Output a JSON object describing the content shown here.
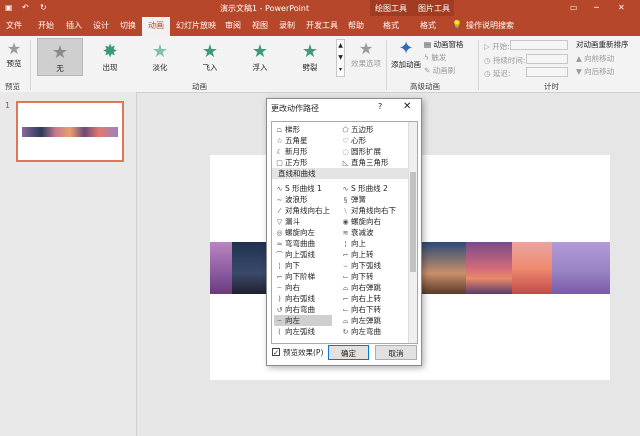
{
  "title_bar": {
    "autosave_icons": "undo-redo",
    "doc_title": "演示文稿1 - PowerPoint",
    "context_tool_drawing": "绘图工具",
    "context_tool_picture": "图片工具"
  },
  "tabs": [
    {
      "label": "文件"
    },
    {
      "label": "开始"
    },
    {
      "label": "插入"
    },
    {
      "label": "设计"
    },
    {
      "label": "切换"
    },
    {
      "label": "动画",
      "active": true
    },
    {
      "label": "幻灯片放映"
    },
    {
      "label": "审阅"
    },
    {
      "label": "视图"
    },
    {
      "label": "录制"
    },
    {
      "label": "开发工具"
    },
    {
      "label": "帮助"
    },
    {
      "label": "格式"
    },
    {
      "label": "格式"
    }
  ],
  "tell_me": "操作说明搜索",
  "ribbon": {
    "preview": {
      "label": "预览",
      "group": "预览"
    },
    "animations": [
      {
        "label": "无",
        "selected": true,
        "color": "#8a8a8a"
      },
      {
        "label": "出现",
        "color": "#3c9a7a"
      },
      {
        "label": "淡化",
        "color": "#3c9a7a"
      },
      {
        "label": "飞入",
        "color": "#3c9a7a"
      },
      {
        "label": "浮入",
        "color": "#3c9a7a"
      },
      {
        "label": "劈裂",
        "color": "#3c9a7a"
      }
    ],
    "effect_options": "效果选项",
    "animation_group": "动画",
    "add_animation": "添加动画",
    "animation_pane": "动画窗格",
    "trigger": "触发",
    "animation_painter": "动画刷",
    "advanced_group": "高级动画",
    "start_label": "开始:",
    "duration_label": "持续时间:",
    "delay_label": "延迟:",
    "timing_group": "计时",
    "reorder_title": "对动画重新排序",
    "move_earlier": "向前移动",
    "move_later": "向后移动"
  },
  "slide_panel": {
    "slide_number": "1"
  },
  "dialog": {
    "title": "更改动作路径",
    "help": "?",
    "close": "✕",
    "category": "直线和曲线",
    "items_left": [
      "梯形",
      "五角星",
      "新月形",
      "正方形",
      "S 形曲线 1",
      "波浪形",
      "对角线向右上",
      "漏斗",
      "螺旋向左",
      "弯弯曲曲",
      "向上弧线",
      "向下",
      "向下阶梯",
      "向右",
      "向右弧线",
      "向右弯曲",
      "向左",
      "向左弧线"
    ],
    "items_right": [
      "五边形",
      "心形",
      "圆形扩展",
      "直角三角形",
      "S 形曲线 2",
      "弹簧",
      "对角线向右下",
      "螺旋向右",
      "衰减波",
      "向上",
      "向上转",
      "向下弧线",
      "向下转",
      "向右弹跳",
      "向右上转",
      "向右下转",
      "向左弹跳",
      "向左弯曲"
    ],
    "selected_item": "向左",
    "preview_checked": true,
    "preview_label": "预览效果(P)",
    "ok": "确定",
    "cancel": "取消"
  }
}
